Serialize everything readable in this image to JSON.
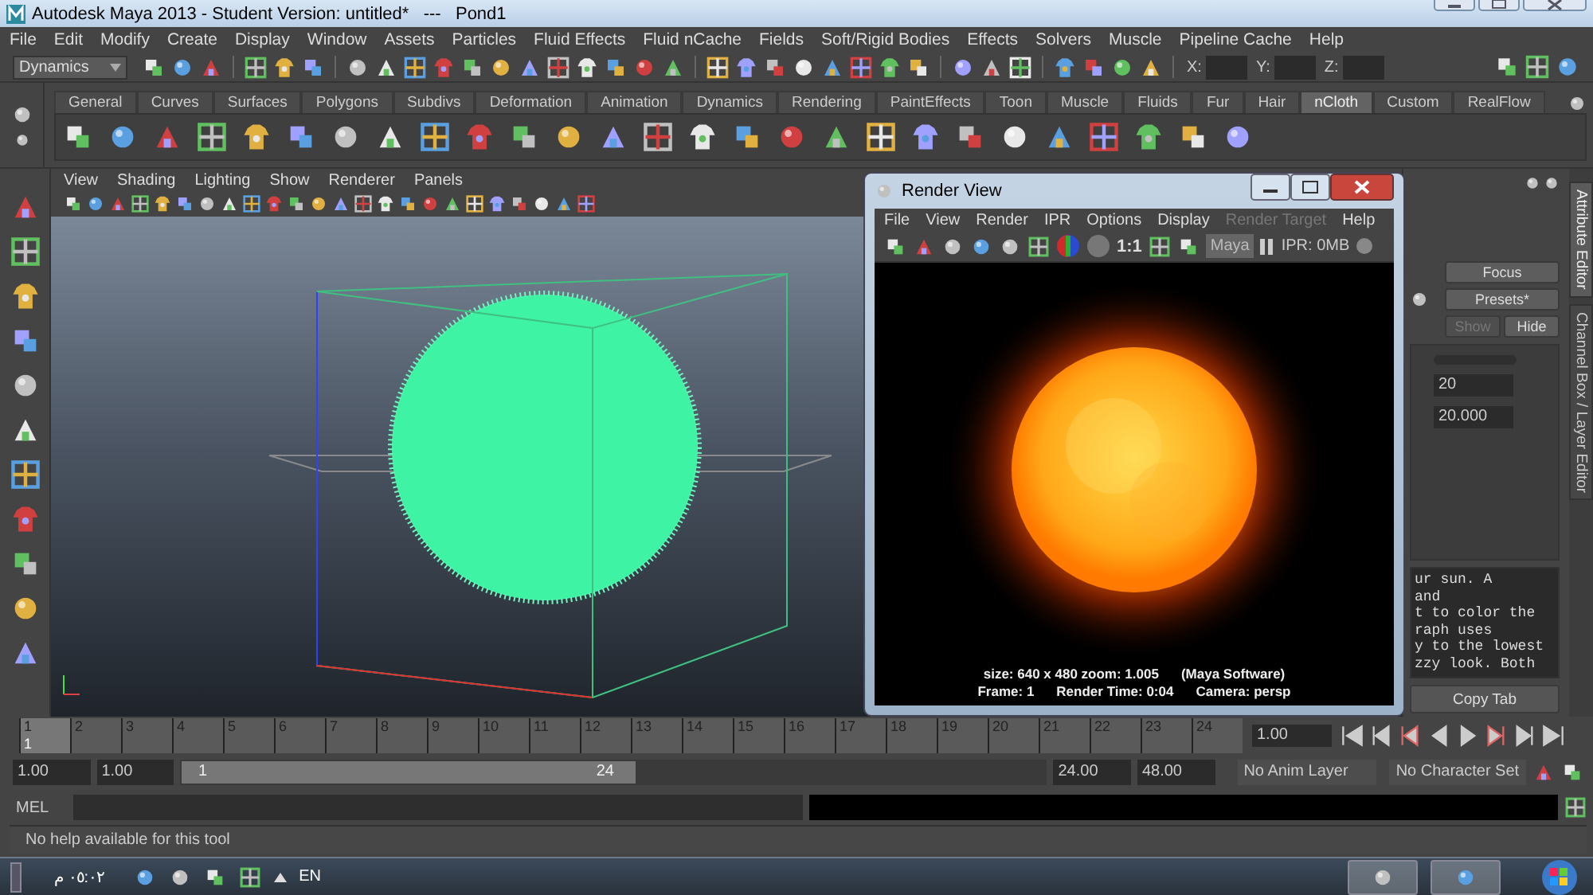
{
  "window": {
    "title": "Autodesk Maya 2013 - Student Version: untitled*   ---   Pond1"
  },
  "menu_bar": [
    "File",
    "Edit",
    "Modify",
    "Create",
    "Display",
    "Window",
    "Assets",
    "Particles",
    "Fluid Effects",
    "Fluid nCache",
    "Fields",
    "Soft/Rigid Bodies",
    "Effects",
    "Solvers",
    "Muscle",
    "Pipeline Cache",
    "Help"
  ],
  "toolbar": {
    "menu_set": "Dynamics",
    "coordinates": [
      "X:",
      "Y:",
      "Z:"
    ]
  },
  "shelf": {
    "tabs": [
      {
        "label": "General",
        "selected": false
      },
      {
        "label": "Curves",
        "selected": false
      },
      {
        "label": "Surfaces",
        "selected": false
      },
      {
        "label": "Polygons",
        "selected": false
      },
      {
        "label": "Subdivs",
        "selected": false
      },
      {
        "label": "Deformation",
        "selected": false
      },
      {
        "label": "Animation",
        "selected": false
      },
      {
        "label": "Dynamics",
        "selected": false
      },
      {
        "label": "Rendering",
        "selected": false
      },
      {
        "label": "PaintEffects",
        "selected": false
      },
      {
        "label": "Toon",
        "selected": false
      },
      {
        "label": "Muscle",
        "selected": false
      },
      {
        "label": "Fluids",
        "selected": false
      },
      {
        "label": "Fur",
        "selected": false
      },
      {
        "label": "Hair",
        "selected": false
      },
      {
        "label": "nCloth",
        "selected": true
      },
      {
        "label": "Custom",
        "selected": false
      },
      {
        "label": "RealFlow",
        "selected": false
      }
    ]
  },
  "viewport": {
    "menu": [
      "View",
      "Shading",
      "Lighting",
      "Show",
      "Renderer",
      "Panels"
    ]
  },
  "render_view": {
    "title": "Render View",
    "menu": [
      {
        "label": "File",
        "disabled": false
      },
      {
        "label": "View",
        "disabled": false
      },
      {
        "label": "Render",
        "disabled": false
      },
      {
        "label": "IPR",
        "disabled": false
      },
      {
        "label": "Options",
        "disabled": false
      },
      {
        "label": "Display",
        "disabled": false
      },
      {
        "label": "Render Target",
        "disabled": true
      },
      {
        "label": "Help",
        "disabled": false
      }
    ],
    "ratio": "1:1",
    "renderer": "Maya",
    "ipr": "IPR: 0MB",
    "info": [
      [
        "size: 640 x 480 zoom: 1.005",
        "(Maya Software)"
      ],
      [
        "Frame: 1",
        "Render Time: 0:04",
        "Camera: persp"
      ]
    ]
  },
  "attribute_editor": {
    "buttons": [
      {
        "label": "Focus",
        "disabled": false
      },
      {
        "label": "Presets*",
        "disabled": false
      },
      {
        "label": "Show",
        "disabled": true
      },
      {
        "label": "Hide",
        "disabled": false
      }
    ],
    "fields": [
      "20",
      "20.000"
    ],
    "notes": [
      "ur sun. A",
      "and",
      "t to color the",
      "raph uses",
      "y to the lowest",
      "zzy look. Both"
    ],
    "copy_button": "Copy Tab",
    "side_tabs": [
      {
        "label": "Attribute Editor",
        "selected": true
      },
      {
        "label": "Channel Box / Layer Editor",
        "selected": false
      }
    ]
  },
  "timeline": {
    "ticks": [
      "1",
      "2",
      "3",
      "4",
      "5",
      "6",
      "7",
      "8",
      "9",
      "10",
      "11",
      "12",
      "13",
      "14",
      "15",
      "16",
      "17",
      "18",
      "19",
      "20",
      "21",
      "22",
      "23",
      "24"
    ],
    "current": "1",
    "current_field": "1.00"
  },
  "range": {
    "start": "1.00",
    "playback_start": "1.00",
    "slider_start": "1",
    "slider_end": "24",
    "playback_end": "24.00",
    "end": "48.00",
    "anim_layer": "No Anim Layer",
    "character_set": "No Character Set"
  },
  "command_line": {
    "label": "MEL"
  },
  "help_line": "No help available for this tool",
  "taskbar": {
    "clock": "م ٠٥:٠٢",
    "language": "EN"
  }
}
